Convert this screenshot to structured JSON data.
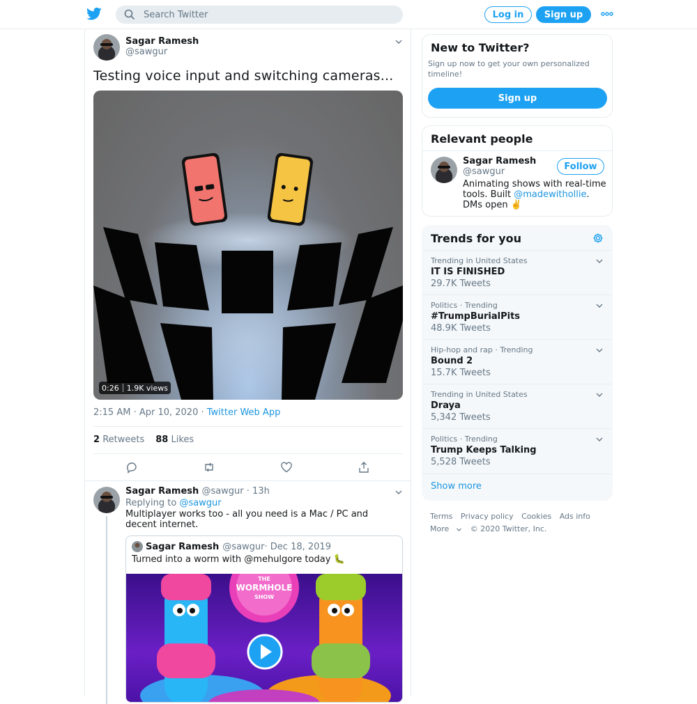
{
  "header": {
    "search_placeholder": "Search Twitter",
    "login_label": "Log in",
    "signup_label": "Sign up"
  },
  "tweet": {
    "name": "Sagar Ramesh",
    "handle": "@sawgur",
    "text": "Testing voice input and switching cameras...",
    "video_duration": "0:26",
    "video_views": "1.9K views",
    "timestamp": "2:15 AM · Apr 10, 2020 · ",
    "source": "Twitter Web App",
    "retweets_count": "2",
    "retweets_label": "Retweets",
    "likes_count": "88",
    "likes_label": "Likes",
    "actions": [
      "reply-icon",
      "retweet-icon",
      "like-icon",
      "share-icon"
    ]
  },
  "reply": {
    "name": "Sagar Ramesh",
    "handle": "@sawgur",
    "time": " · 13h",
    "replying_prefix": "Replying to ",
    "replying_to": "@sawgur",
    "text": "Multiplayer works too - all you need is a Mac / PC and decent internet.",
    "quote": {
      "name": "Sagar Ramesh",
      "handle": "@sawgur",
      "date": " · Dec 18, 2019",
      "text": "Turned into a worm with @mehulgore today 🐛",
      "media_sign_top": "THE",
      "media_sign_main": "WORMHOLE",
      "media_sign_bottom": "SHOW"
    }
  },
  "sidebar": {
    "new_to_twitter": {
      "title": "New to Twitter?",
      "subtitle": "Sign up now to get your own personalized timeline!",
      "button": "Sign up"
    },
    "relevant_people": {
      "title": "Relevant people",
      "name": "Sagar Ramesh",
      "handle": "@sawgur",
      "follow_label": "Follow",
      "bio_before": "Animating shows with real-time tools. Built ",
      "bio_link": "@madewithollie",
      "bio_after": ". DMs open ✌️"
    },
    "trends": {
      "title": "Trends for you",
      "items": [
        {
          "context": "Trending in United States",
          "name": "IT IS FINISHED",
          "count": "29.7K Tweets"
        },
        {
          "context": "Politics · Trending",
          "name": "#TrumpBurialPits",
          "count": "48.9K Tweets"
        },
        {
          "context": "Hip-hop and rap · Trending",
          "name": "Bound 2",
          "count": "15.7K Tweets"
        },
        {
          "context": "Trending in United States",
          "name": "Draya",
          "count": "5,342 Tweets"
        },
        {
          "context": "Politics · Trending",
          "name": "Trump Keeps Talking",
          "count": "5,528 Tweets"
        }
      ],
      "show_more": "Show more"
    },
    "footer": {
      "links": [
        "Terms",
        "Privacy policy",
        "Cookies",
        "Ads info"
      ],
      "more": "More",
      "copyright": "© 2020 Twitter, Inc."
    }
  },
  "colors": {
    "accent": "#1da1f2",
    "link": "#1b95e0",
    "muted": "#657786"
  }
}
